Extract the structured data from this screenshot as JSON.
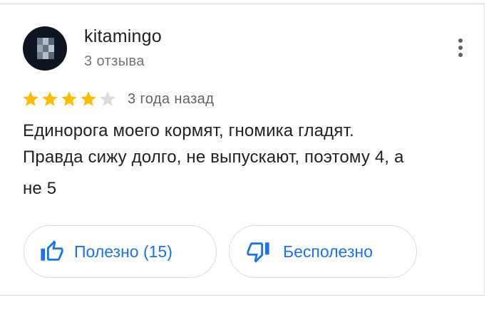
{
  "review": {
    "username": "kitamingo",
    "reviews_count": "3 отзыва",
    "rating": 4,
    "rating_max": 5,
    "age": "3 года назад",
    "text_lines": [
      "Единорога моего кормят, гномика гладят.",
      "Правда сижу долго, не выпускают, поэтому 4, а",
      "не 5"
    ]
  },
  "actions": {
    "helpful_label": "Полезно (15)",
    "unhelpful_label": "Бесполезно"
  },
  "icons": {
    "avatar": "pixelated-avatar",
    "more": "more-vert-icon",
    "star_filled": "star-filled-icon",
    "star_empty": "star-empty-icon",
    "thumb_up": "thumb-up-icon",
    "thumb_down": "thumb-down-icon"
  },
  "colors": {
    "star_filled": "#fbbc04",
    "star_empty": "#dadce0",
    "accent": "#1a73e8",
    "text_primary": "#202124",
    "text_secondary": "#70757a",
    "border": "#dadce0"
  }
}
